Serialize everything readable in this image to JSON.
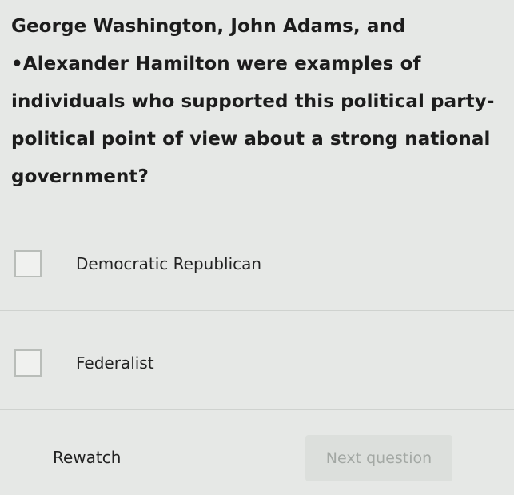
{
  "question": {
    "text": "George Washington, John Adams, and •Alexander Hamilton were examples of individuals who supported this political party-political point of view about a strong national government?"
  },
  "options": [
    {
      "label": "Democratic Republican",
      "checked": false
    },
    {
      "label": "Federalist",
      "checked": false
    }
  ],
  "footer": {
    "rewatch_label": "Rewatch",
    "next_label": "Next question",
    "next_enabled": false
  },
  "colors": {
    "background": "#e6e8e6",
    "text": "#1c1c1c",
    "disabled_text": "#a3a8a4"
  }
}
